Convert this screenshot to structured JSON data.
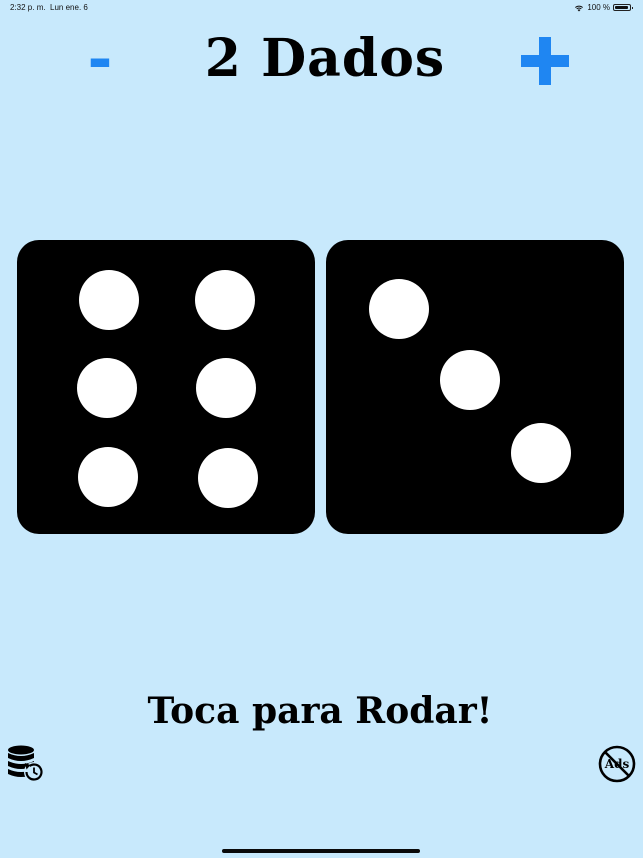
{
  "status_bar": {
    "time": "2:32 p. m.",
    "date": "Lun ene. 6",
    "battery": "100 %",
    "icons": [
      "wifi-icon",
      "battery-icon"
    ]
  },
  "header": {
    "minus_label": "-",
    "plus_icon": "plus-icon",
    "title": "2 Dados"
  },
  "dice": [
    {
      "value": 6
    },
    {
      "value": 3
    }
  ],
  "footer": {
    "roll_label": "Toca para Rodar!",
    "reset_icon": "database-reset-icon",
    "noads_icon": "no-ads-icon",
    "noads_text": "Ads"
  },
  "colors": {
    "background": "#c8e9fc",
    "accent": "#1f86f2",
    "die": "#000000",
    "pip": "#ffffff"
  }
}
